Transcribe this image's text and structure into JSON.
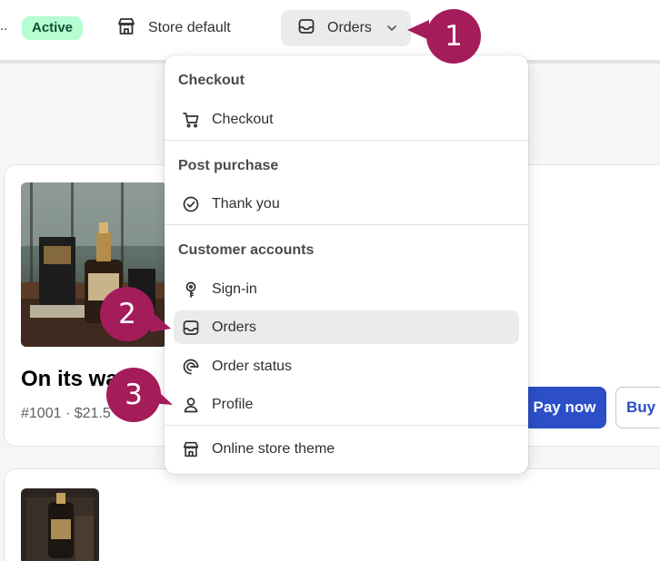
{
  "topbar": {
    "truncated_text": "..",
    "status_badge": "Active",
    "store_default_label": "Store default",
    "page_selector_label": "Orders"
  },
  "dropdown": {
    "sections": [
      {
        "heading": "Checkout",
        "items": [
          {
            "label": "Checkout",
            "icon": "cart-icon"
          }
        ]
      },
      {
        "heading": "Post purchase",
        "items": [
          {
            "label": "Thank you",
            "icon": "check-circle-icon"
          }
        ]
      },
      {
        "heading": "Customer accounts",
        "items": [
          {
            "label": "Sign-in",
            "icon": "key-icon"
          },
          {
            "label": "Orders",
            "icon": "inbox-icon",
            "selected": true
          },
          {
            "label": "Order status",
            "icon": "order-status-icon"
          },
          {
            "label": "Profile",
            "icon": "person-icon"
          }
        ]
      }
    ],
    "footer_item": {
      "label": "Online store theme",
      "icon": "store-icon"
    }
  },
  "order_card": {
    "title": "On its wa",
    "meta": "#1001 · $21.5",
    "pay_now_label": "Pay now",
    "buy_label": "Buy"
  },
  "callouts": [
    "1",
    "2",
    "3"
  ],
  "colors": {
    "accent": "#2c4ec7",
    "callout": "#a51c5b",
    "badge_bg": "#b4fed2",
    "badge_text": "#0c5132",
    "selected_bg": "#ebebeb"
  }
}
